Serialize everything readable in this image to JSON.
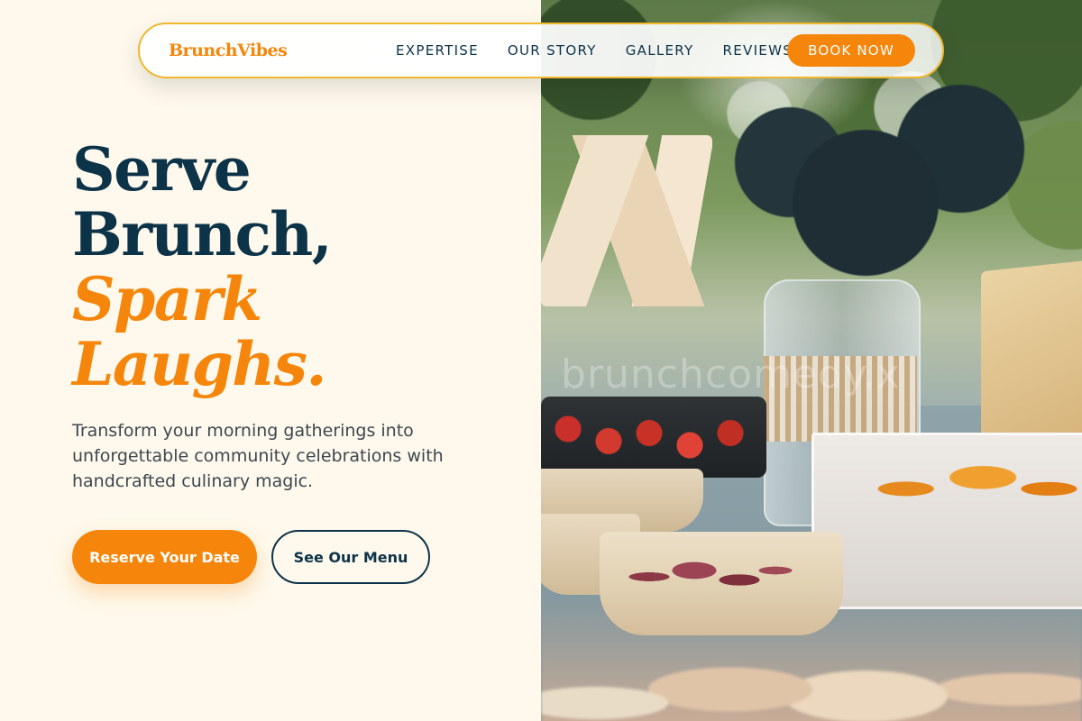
{
  "brand": {
    "name": "BrunchVibes",
    "accent_color": "#F5860B",
    "dark_color": "#0D3349",
    "background_color": "#FEF9EC"
  },
  "nav": {
    "links": [
      "EXPERTISE",
      "OUR STORY",
      "GALLERY",
      "REVIEWS"
    ],
    "cta_label": "BOOK NOW"
  },
  "hero": {
    "headline_line1": "Serve",
    "headline_line2": "Brunch,",
    "headline_accent_line1": "Spark",
    "headline_accent_line2": "Laughs.",
    "subtext": "Transform your morning gatherings into unforgettable community celebrations with handcrafted culinary magic.",
    "primary_button": "Reserve Your Date",
    "secondary_button": "See Our Menu"
  },
  "image": {
    "watermark": "brunchcomedy.x"
  }
}
